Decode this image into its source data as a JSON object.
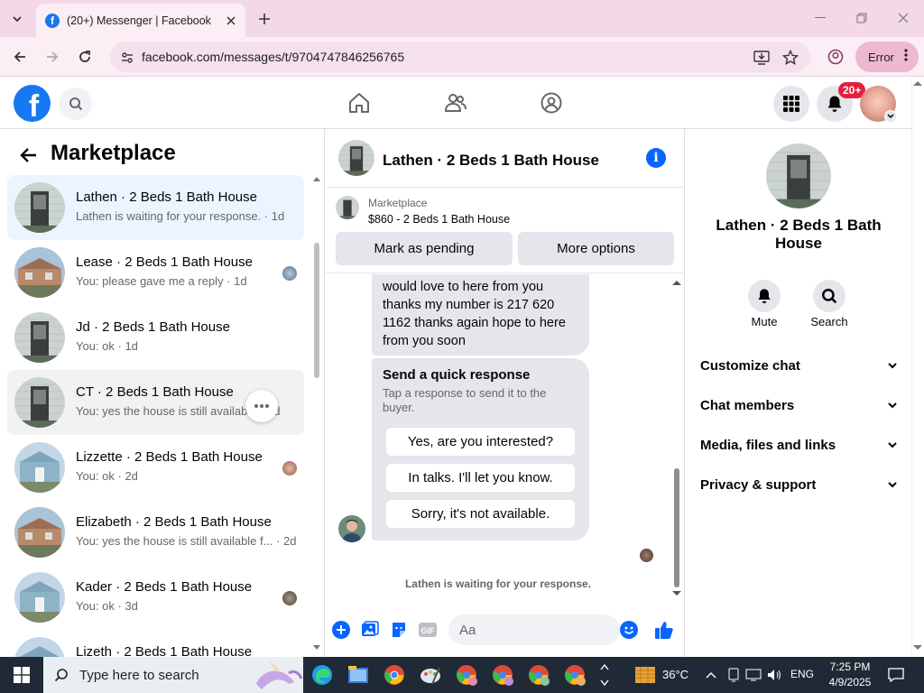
{
  "browser": {
    "tab_title": "(20+) Messenger | Facebook",
    "url": "facebook.com/messages/t/9704747846256765",
    "profile_status": "Error"
  },
  "fb": {
    "notification_badge": "20+",
    "brand_color": "#1877f2"
  },
  "left": {
    "title": "Marketplace",
    "conversations": [
      {
        "name": "Lathen · 2 Beds 1 Bath House",
        "sub": "Lathen is waiting for your response. · 1d"
      },
      {
        "name": "Lease · 2 Beds 1 Bath House",
        "sub": "You: please gave me a reply · 1d"
      },
      {
        "name": "Jd · 2 Beds 1 Bath House",
        "sub": "You: ok · 1d"
      },
      {
        "name": "CT · 2 Beds 1 Bath House",
        "sub": "You: yes the house is still available · 1d"
      },
      {
        "name": "Lizzette · 2 Beds 1 Bath House",
        "sub": "You: ok · 2d"
      },
      {
        "name": "Elizabeth · 2 Beds 1 Bath House",
        "sub": "You: yes the house is still available f... · 2d"
      },
      {
        "name": "Kader · 2 Beds 1 Bath House",
        "sub": "You: ok · 3d"
      },
      {
        "name": "Lizeth · 2 Beds 1 Bath House",
        "sub": ""
      }
    ]
  },
  "chat": {
    "title": "Lathen · 2 Beds 1 Bath House",
    "listing_source": "Marketplace",
    "listing_detail": "$860 - 2 Beds 1 Bath House",
    "mark_pending": "Mark as pending",
    "more_options": "More options",
    "message_text": "would love to here from you thanks my number is 217 620 1162 thanks again hope to here from you soon",
    "quick_title": "Send a quick response",
    "quick_desc": "Tap a response to send it to the buyer.",
    "quick_responses": [
      "Yes, are you interested?",
      "In talks. I'll let you know.",
      "Sorry, it's not available."
    ],
    "waiting_text": "Lathen is waiting for your response.",
    "input_placeholder": "Aa"
  },
  "right": {
    "name": "Lathen · 2 Beds 1 Bath House",
    "mute_label": "Mute",
    "search_label": "Search",
    "sections": [
      "Customize chat",
      "Chat members",
      "Media, files and links",
      "Privacy & support"
    ]
  },
  "taskbar": {
    "search_placeholder": "Type here to search",
    "temperature": "36°C",
    "language": "ENG",
    "time": "7:25 PM",
    "date": "4/9/2025"
  }
}
